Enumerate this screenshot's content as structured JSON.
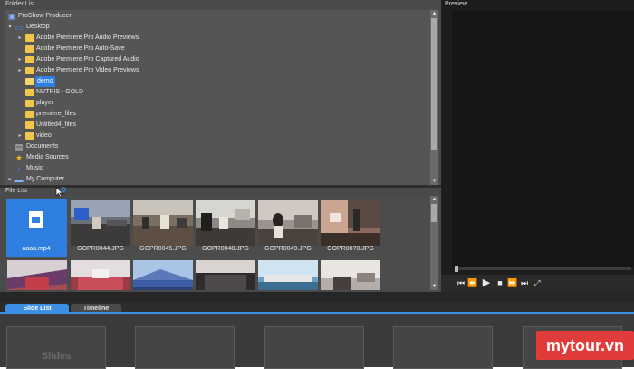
{
  "folder_list": {
    "header": "Folder List",
    "items": [
      {
        "label": "ProShow Producer",
        "icon": "program-icon"
      },
      {
        "label": "Desktop",
        "icon": "desktop-icon"
      },
      {
        "label": "Adobe Premiere Pro Audio Previews",
        "icon": "folder-icon"
      },
      {
        "label": "Adobe Premiere Pro Auto-Save",
        "icon": "folder-icon"
      },
      {
        "label": "Adobe Premiere Pro Captured Audio",
        "icon": "folder-icon"
      },
      {
        "label": "Adobe Premiere Pro Video Previews",
        "icon": "folder-icon"
      },
      {
        "label": "demo",
        "icon": "folder-icon",
        "selected": true
      },
      {
        "label": "NUTRIS - GOLD",
        "icon": "folder-icon"
      },
      {
        "label": "player",
        "icon": "folder-icon"
      },
      {
        "label": "premiere_files",
        "icon": "folder-icon"
      },
      {
        "label": "Untitled4_files",
        "icon": "folder-icon"
      },
      {
        "label": "video",
        "icon": "folder-icon"
      },
      {
        "label": "Documents",
        "icon": "documents-icon"
      },
      {
        "label": "Media Sources",
        "icon": "star-icon"
      },
      {
        "label": "Music",
        "icon": "music-icon"
      },
      {
        "label": "My Computer",
        "icon": "computer-icon"
      }
    ]
  },
  "file_list": {
    "header": "File List",
    "files": [
      {
        "name": "aaaa.mp4",
        "selected": true
      },
      {
        "name": "GOPR0044.JPG"
      },
      {
        "name": "GOPR0045.JPG"
      },
      {
        "name": "GOPR0048.JPG"
      },
      {
        "name": "GOPR0049.JPG"
      },
      {
        "name": "GOPR0070.JPG"
      }
    ]
  },
  "preview": {
    "header": "Preview"
  },
  "tabs": [
    {
      "label": "Slide List",
      "active": true
    },
    {
      "label": "Timeline",
      "active": false
    }
  ],
  "slides_label": "Slides",
  "watermark": "mytour.vn",
  "colors": {
    "selection": "#2f7fe0",
    "accent_tab": "#3d8fe6",
    "folder": "#f1c64a",
    "watermark_bg": "#e23b3b"
  }
}
